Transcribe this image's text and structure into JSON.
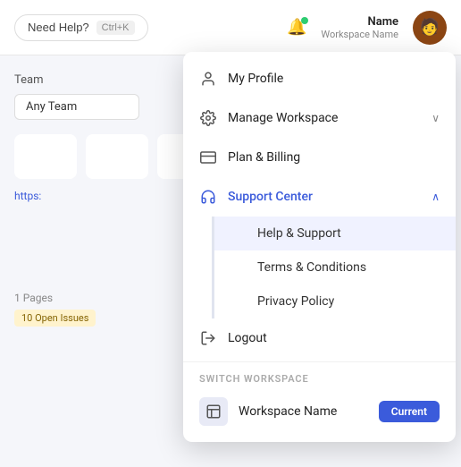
{
  "header": {
    "need_help_label": "Need Help?",
    "shortcut": "Ctrl+K",
    "user_name": "Name",
    "workspace_name": "Workspace Name",
    "avatar_emoji": "🧑"
  },
  "background": {
    "team_label": "Team",
    "team_value": "Any Team",
    "link_text": "https:",
    "pages_text": "1 Pages",
    "open_issues": "10 Open Issues"
  },
  "dropdown": {
    "my_profile": "My Profile",
    "manage_workspace": "Manage Workspace",
    "plan_billing": "Plan & Billing",
    "support_center": "Support Center",
    "help_support": "Help & Support",
    "terms_conditions": "Terms & Conditions",
    "privacy_policy": "Privacy Policy",
    "logout": "Logout",
    "switch_workspace_label": "SWITCH WORKSPACE",
    "workspace_row_name": "Workspace Name",
    "current_badge": "Current"
  },
  "icons": {
    "profile": "👤",
    "gear": "⚙",
    "billing": "💳",
    "support": "🎧",
    "logout": "↪",
    "workspace": "🏢",
    "bell": "🔔",
    "chevron_down": "∨",
    "chevron_up": "∧"
  }
}
